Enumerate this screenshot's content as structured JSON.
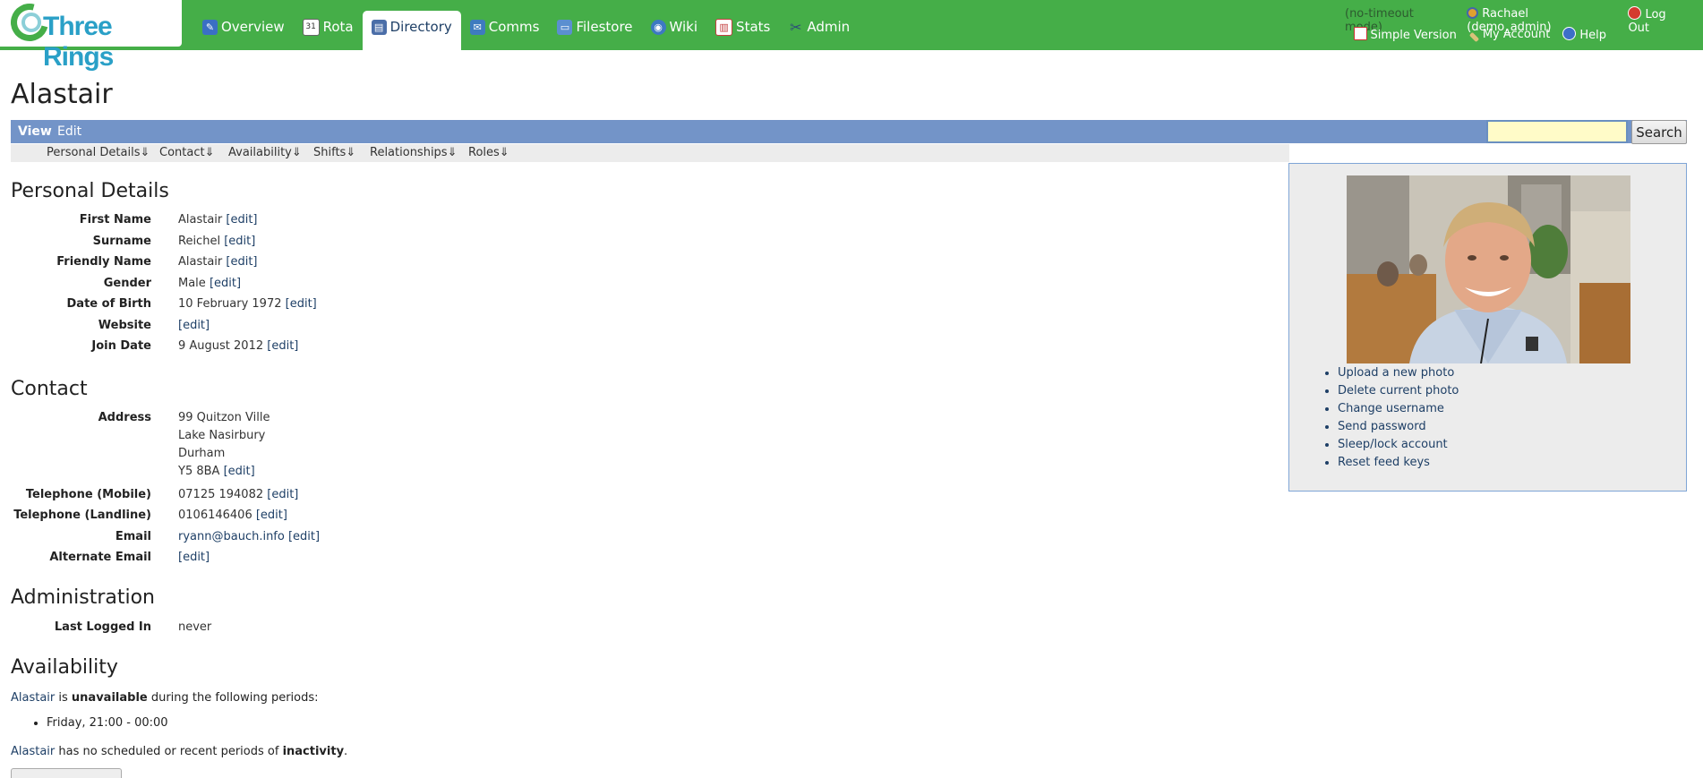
{
  "logo": {
    "text": "Three Rings"
  },
  "nav": {
    "items": [
      {
        "label": "Overview",
        "icon": "overview-icon",
        "color": "#3a6fc4"
      },
      {
        "label": "Rota",
        "icon": "calendar-icon",
        "color": "#666666"
      },
      {
        "label": "Directory",
        "icon": "directory-icon",
        "color": "#4b6ea8",
        "active": true
      },
      {
        "label": "Comms",
        "icon": "comms-icon",
        "color": "#3e7bbf"
      },
      {
        "label": "Filestore",
        "icon": "folder-icon",
        "color": "#5b8fd0"
      },
      {
        "label": "Wiki",
        "icon": "wiki-icon",
        "color": "#3d79c2"
      },
      {
        "label": "Stats",
        "icon": "stats-icon",
        "color": "#c44040"
      },
      {
        "label": "Admin",
        "icon": "tools-icon",
        "color": "#4f6d9a"
      }
    ]
  },
  "userbar": {
    "mode": "(no-timeout mode)",
    "user": "Rachael (demo_admin)",
    "logout": "Log Out",
    "simple_version": "Simple Version",
    "my_account": "My Account",
    "help": "Help"
  },
  "page": {
    "title": "Alastair"
  },
  "viewbar": {
    "view": "View",
    "edit": "Edit",
    "search_button": "Search",
    "search_value": ""
  },
  "subnav": [
    "Personal Details⇓",
    "Contact⇓",
    "Availability⇓",
    "Shifts⇓",
    "Relationships⇓",
    "Roles⇓"
  ],
  "personal": {
    "heading": "Personal Details",
    "fields": [
      {
        "label": "First Name",
        "value": "Alastair",
        "edit": "[edit]"
      },
      {
        "label": "Surname",
        "value": "Reichel",
        "edit": "[edit]"
      },
      {
        "label": "Friendly Name",
        "value": "Alastair",
        "edit": "[edit]"
      },
      {
        "label": "Gender",
        "value": "Male",
        "edit": "[edit]"
      },
      {
        "label": "Date of Birth",
        "value": "10 February 1972",
        "edit": "[edit]"
      },
      {
        "label": "Website",
        "value": "",
        "edit": "[edit]"
      },
      {
        "label": "Join Date",
        "value": "9 August 2012",
        "edit": "[edit]"
      }
    ]
  },
  "contact": {
    "heading": "Contact",
    "address_label": "Address",
    "address_lines": [
      "99 Quitzon Ville",
      "Lake Nasirbury",
      "Durham",
      "Y5 8BA"
    ],
    "address_edit": "[edit]",
    "fields": [
      {
        "label": "Telephone (Mobile)",
        "value": "07125 194082",
        "edit": "[edit]"
      },
      {
        "label": "Telephone (Landline)",
        "value": "0106146406",
        "edit": "[edit]"
      },
      {
        "label": "Email",
        "value": "ryann@bauch.info",
        "edit": "[edit]"
      },
      {
        "label": "Alternate Email",
        "value": "",
        "edit": "[edit]"
      }
    ]
  },
  "administration": {
    "heading": "Administration",
    "last_logged_in_label": "Last Logged In",
    "last_logged_in_value": "never"
  },
  "availability": {
    "heading": "Availability",
    "name": "Alastair",
    "text_is": " is ",
    "unavailable": "unavailable",
    "text_during": " during the following periods:",
    "periods": [
      "Friday, 21:00 - 00:00"
    ],
    "text_has": " has no scheduled or recent periods of ",
    "inactivity": "inactivity",
    "period_end": "."
  },
  "photo_panel": {
    "actions": [
      "Upload a new photo",
      "Delete current photo",
      "Change username",
      "Send password",
      "Sleep/lock account",
      "Reset feed keys"
    ]
  },
  "colors": {
    "header_green": "#45ae48",
    "viewbar_blue": "#7394c8",
    "link": "#1e3f66",
    "search_bg": "#fffbc8"
  }
}
